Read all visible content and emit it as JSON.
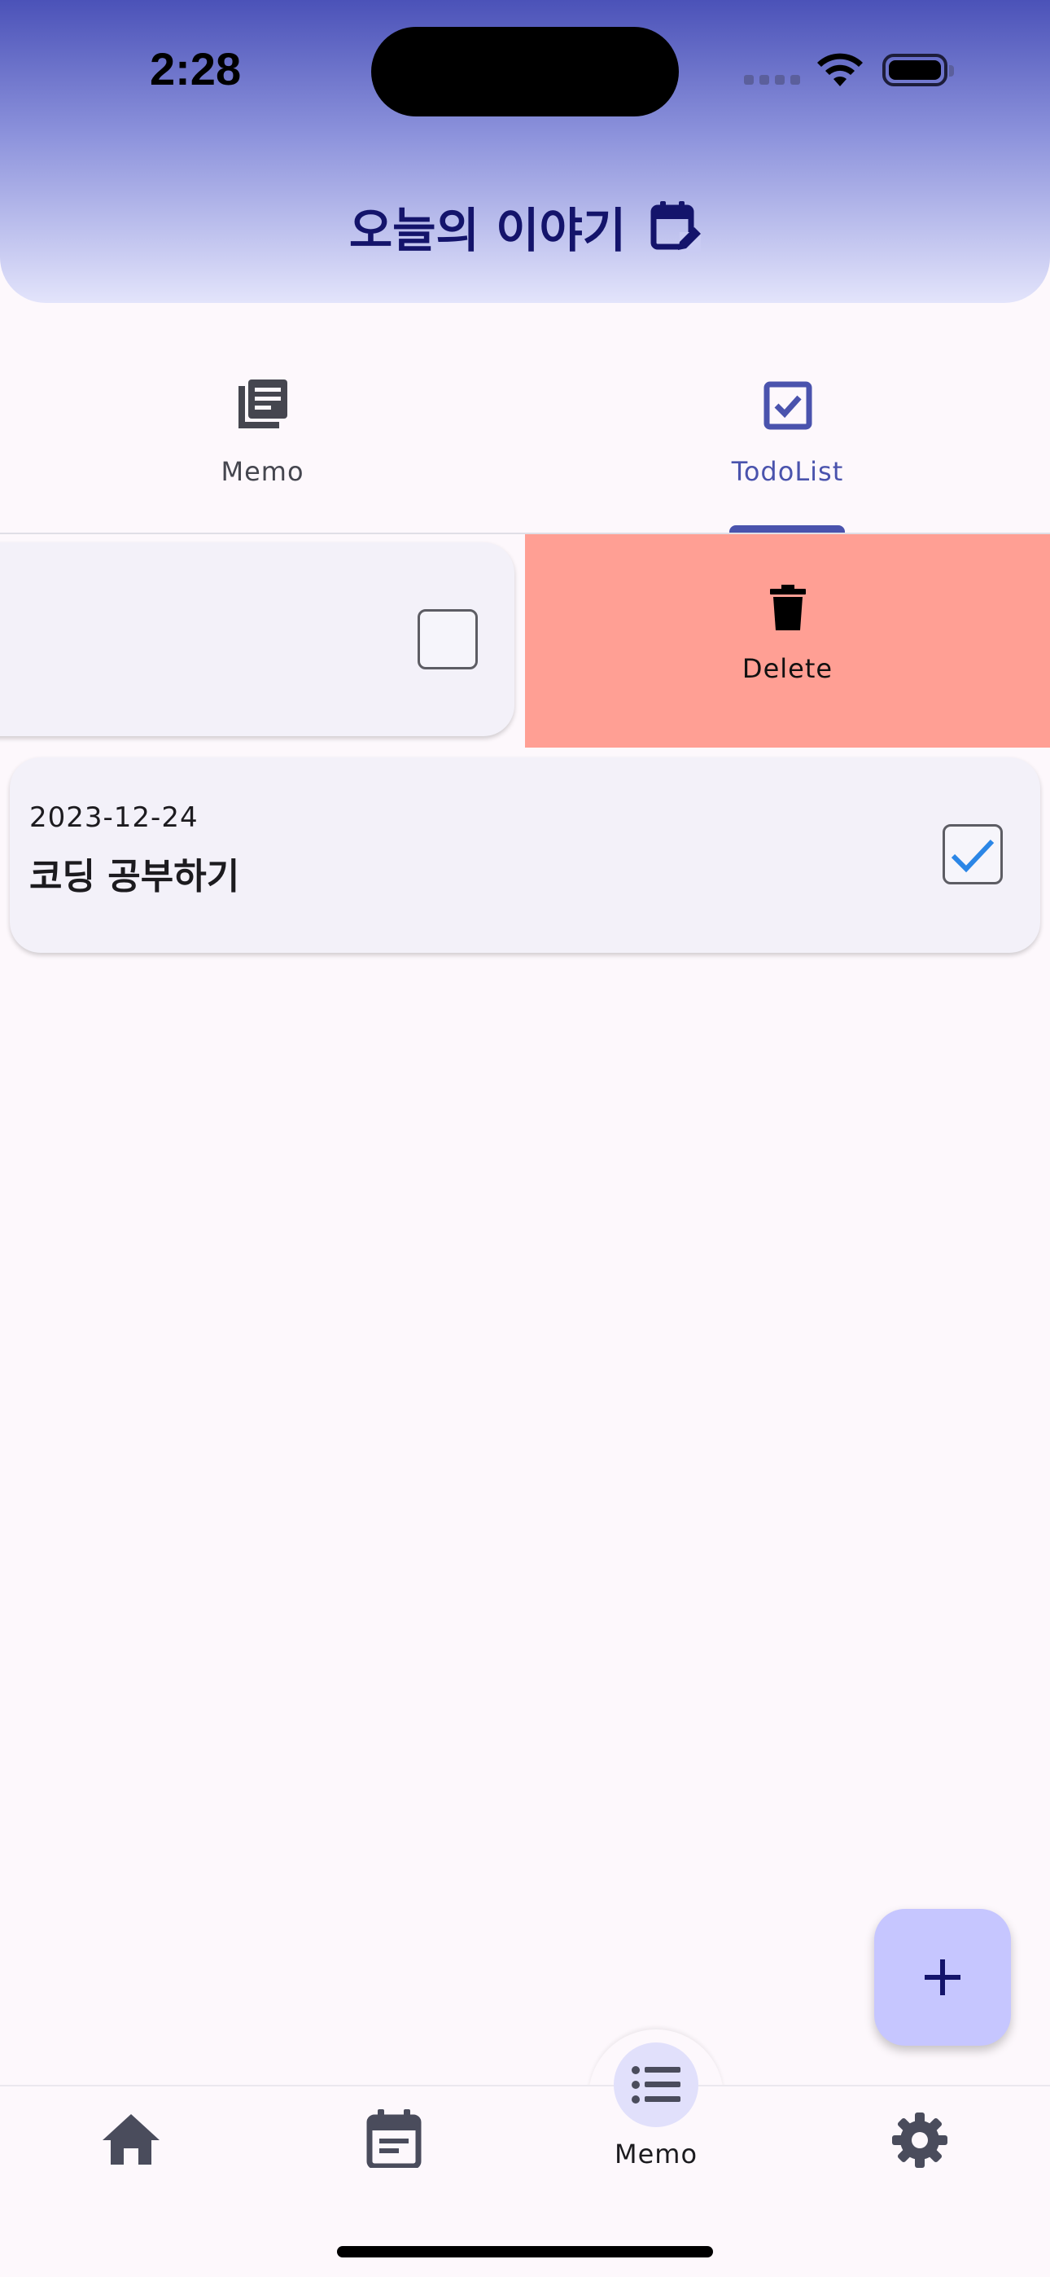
{
  "status_bar": {
    "time": "2:28"
  },
  "header": {
    "title": "오늘의 이야기",
    "title_icon": "calendar-edit-icon"
  },
  "tabs": [
    {
      "label": "Memo",
      "icon": "newspaper-icon",
      "selected": false
    },
    {
      "label": "TodoList",
      "icon": "checkbox-icon",
      "selected": true
    }
  ],
  "swiped_item": {
    "checked": false,
    "action": {
      "label": "Delete",
      "icon": "trash-icon",
      "color": "#ff9f94"
    }
  },
  "todos": [
    {
      "date": "2023-12-24",
      "title": "코딩 공부하기",
      "checked": true
    }
  ],
  "fab": {
    "icon": "plus-icon",
    "color": "#c6c6ff"
  },
  "bottom_nav": {
    "items": [
      {
        "icon": "home-icon",
        "label": "",
        "active": false
      },
      {
        "icon": "calendar-icon",
        "label": "",
        "active": false
      },
      {
        "icon": "list-icon",
        "label": "Memo",
        "active": true
      },
      {
        "icon": "settings-icon",
        "label": "",
        "active": false
      }
    ]
  },
  "colors": {
    "accent": "#4a53ad",
    "title": "#14146b",
    "background": "#fdf8fc",
    "card": "#f3f1f9",
    "check": "#2b86e6"
  }
}
